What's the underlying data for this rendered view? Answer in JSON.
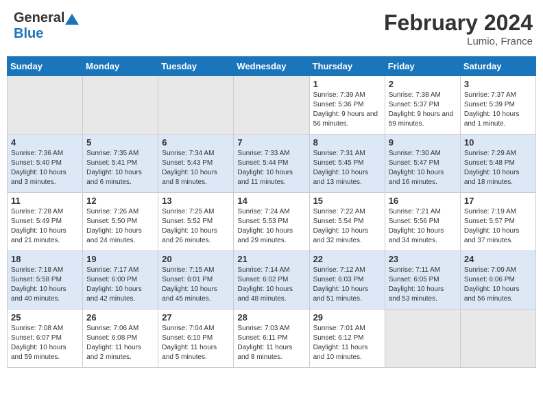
{
  "header": {
    "logo_general": "General",
    "logo_blue": "Blue",
    "title": "February 2024",
    "location": "Lumio, France"
  },
  "weekdays": [
    "Sunday",
    "Monday",
    "Tuesday",
    "Wednesday",
    "Thursday",
    "Friday",
    "Saturday"
  ],
  "days": [
    {
      "date": "",
      "empty": true
    },
    {
      "date": "",
      "empty": true
    },
    {
      "date": "",
      "empty": true
    },
    {
      "date": "",
      "empty": true
    },
    {
      "date": "1",
      "sunrise": "Sunrise: 7:39 AM",
      "sunset": "Sunset: 5:36 PM",
      "daylight": "Daylight: 9 hours and 56 minutes."
    },
    {
      "date": "2",
      "sunrise": "Sunrise: 7:38 AM",
      "sunset": "Sunset: 5:37 PM",
      "daylight": "Daylight: 9 hours and 59 minutes."
    },
    {
      "date": "3",
      "sunrise": "Sunrise: 7:37 AM",
      "sunset": "Sunset: 5:39 PM",
      "daylight": "Daylight: 10 hours and 1 minute."
    },
    {
      "date": "4",
      "sunrise": "Sunrise: 7:36 AM",
      "sunset": "Sunset: 5:40 PM",
      "daylight": "Daylight: 10 hours and 3 minutes."
    },
    {
      "date": "5",
      "sunrise": "Sunrise: 7:35 AM",
      "sunset": "Sunset: 5:41 PM",
      "daylight": "Daylight: 10 hours and 6 minutes."
    },
    {
      "date": "6",
      "sunrise": "Sunrise: 7:34 AM",
      "sunset": "Sunset: 5:43 PM",
      "daylight": "Daylight: 10 hours and 8 minutes."
    },
    {
      "date": "7",
      "sunrise": "Sunrise: 7:33 AM",
      "sunset": "Sunset: 5:44 PM",
      "daylight": "Daylight: 10 hours and 11 minutes."
    },
    {
      "date": "8",
      "sunrise": "Sunrise: 7:31 AM",
      "sunset": "Sunset: 5:45 PM",
      "daylight": "Daylight: 10 hours and 13 minutes."
    },
    {
      "date": "9",
      "sunrise": "Sunrise: 7:30 AM",
      "sunset": "Sunset: 5:47 PM",
      "daylight": "Daylight: 10 hours and 16 minutes."
    },
    {
      "date": "10",
      "sunrise": "Sunrise: 7:29 AM",
      "sunset": "Sunset: 5:48 PM",
      "daylight": "Daylight: 10 hours and 18 minutes."
    },
    {
      "date": "11",
      "sunrise": "Sunrise: 7:28 AM",
      "sunset": "Sunset: 5:49 PM",
      "daylight": "Daylight: 10 hours and 21 minutes."
    },
    {
      "date": "12",
      "sunrise": "Sunrise: 7:26 AM",
      "sunset": "Sunset: 5:50 PM",
      "daylight": "Daylight: 10 hours and 24 minutes."
    },
    {
      "date": "13",
      "sunrise": "Sunrise: 7:25 AM",
      "sunset": "Sunset: 5:52 PM",
      "daylight": "Daylight: 10 hours and 26 minutes."
    },
    {
      "date": "14",
      "sunrise": "Sunrise: 7:24 AM",
      "sunset": "Sunset: 5:53 PM",
      "daylight": "Daylight: 10 hours and 29 minutes."
    },
    {
      "date": "15",
      "sunrise": "Sunrise: 7:22 AM",
      "sunset": "Sunset: 5:54 PM",
      "daylight": "Daylight: 10 hours and 32 minutes."
    },
    {
      "date": "16",
      "sunrise": "Sunrise: 7:21 AM",
      "sunset": "Sunset: 5:56 PM",
      "daylight": "Daylight: 10 hours and 34 minutes."
    },
    {
      "date": "17",
      "sunrise": "Sunrise: 7:19 AM",
      "sunset": "Sunset: 5:57 PM",
      "daylight": "Daylight: 10 hours and 37 minutes."
    },
    {
      "date": "18",
      "sunrise": "Sunrise: 7:18 AM",
      "sunset": "Sunset: 5:58 PM",
      "daylight": "Daylight: 10 hours and 40 minutes."
    },
    {
      "date": "19",
      "sunrise": "Sunrise: 7:17 AM",
      "sunset": "Sunset: 6:00 PM",
      "daylight": "Daylight: 10 hours and 42 minutes."
    },
    {
      "date": "20",
      "sunrise": "Sunrise: 7:15 AM",
      "sunset": "Sunset: 6:01 PM",
      "daylight": "Daylight: 10 hours and 45 minutes."
    },
    {
      "date": "21",
      "sunrise": "Sunrise: 7:14 AM",
      "sunset": "Sunset: 6:02 PM",
      "daylight": "Daylight: 10 hours and 48 minutes."
    },
    {
      "date": "22",
      "sunrise": "Sunrise: 7:12 AM",
      "sunset": "Sunset: 6:03 PM",
      "daylight": "Daylight: 10 hours and 51 minutes."
    },
    {
      "date": "23",
      "sunrise": "Sunrise: 7:11 AM",
      "sunset": "Sunset: 6:05 PM",
      "daylight": "Daylight: 10 hours and 53 minutes."
    },
    {
      "date": "24",
      "sunrise": "Sunrise: 7:09 AM",
      "sunset": "Sunset: 6:06 PM",
      "daylight": "Daylight: 10 hours and 56 minutes."
    },
    {
      "date": "25",
      "sunrise": "Sunrise: 7:08 AM",
      "sunset": "Sunset: 6:07 PM",
      "daylight": "Daylight: 10 hours and 59 minutes."
    },
    {
      "date": "26",
      "sunrise": "Sunrise: 7:06 AM",
      "sunset": "Sunset: 6:08 PM",
      "daylight": "Daylight: 11 hours and 2 minutes."
    },
    {
      "date": "27",
      "sunrise": "Sunrise: 7:04 AM",
      "sunset": "Sunset: 6:10 PM",
      "daylight": "Daylight: 11 hours and 5 minutes."
    },
    {
      "date": "28",
      "sunrise": "Sunrise: 7:03 AM",
      "sunset": "Sunset: 6:11 PM",
      "daylight": "Daylight: 11 hours and 8 minutes."
    },
    {
      "date": "29",
      "sunrise": "Sunrise: 7:01 AM",
      "sunset": "Sunset: 6:12 PM",
      "daylight": "Daylight: 11 hours and 10 minutes."
    },
    {
      "date": "",
      "empty": true
    },
    {
      "date": "",
      "empty": true
    }
  ]
}
